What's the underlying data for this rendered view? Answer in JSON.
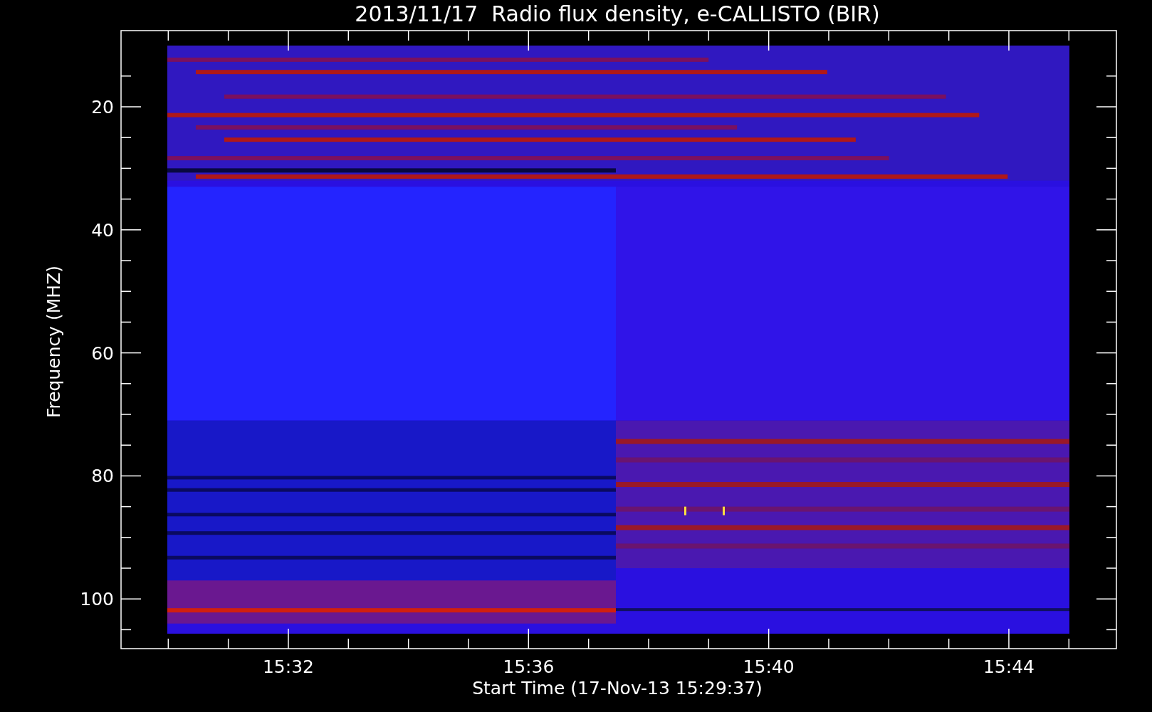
{
  "title": "2013/11/17  Radio flux density, e-CALLISTO (BIR)",
  "y_axis": {
    "label": "Frequency (MHZ)",
    "ticks": [
      "20",
      "40",
      "60",
      "80",
      "100"
    ]
  },
  "x_axis": {
    "label": "Start Time (17-Nov-13 15:29:37)",
    "ticks": [
      "15:32",
      "15:36",
      "15:40",
      "15:44"
    ]
  }
}
